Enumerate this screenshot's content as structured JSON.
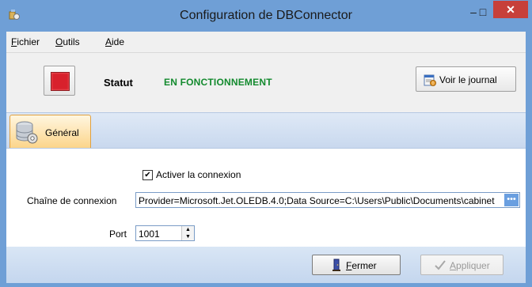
{
  "window": {
    "title": "Configuration de DBConnector",
    "minimize_glyph": "–",
    "maximize_glyph": "□",
    "close_glyph": "✕"
  },
  "menu": {
    "items": [
      {
        "mnemonic": "F",
        "rest": "ichier"
      },
      {
        "mnemonic": "O",
        "rest": "utils"
      },
      {
        "mnemonic": "A",
        "rest": "ide"
      }
    ]
  },
  "status": {
    "label": "Statut",
    "value": "EN FONCTIONNEMENT",
    "value_color": "#138a2e",
    "stop_color": "#d8212c",
    "journal_button": "Voir le journal"
  },
  "tabs": [
    {
      "label": "Général",
      "selected": true
    }
  ],
  "form": {
    "enable_label": "Activer la connexion",
    "enable_checked": true,
    "check_glyph": "✔",
    "connection_label": "Chaîne de connexion",
    "connection_value": "Provider=Microsoft.Jet.OLEDB.4.0;Data Source=C:\\Users\\Public\\Documents\\cabinet",
    "browse_glyph": "•••",
    "port_label": "Port",
    "port_value": "1001",
    "spin_up": "▲",
    "spin_down": "▼"
  },
  "buttons": {
    "close_mnemonic": "F",
    "close_rest": "ermer",
    "apply_mnemonic": "A",
    "apply_rest": "ppliquer",
    "apply_enabled": false
  },
  "icons": {
    "app": "app-icon",
    "stop": "stop-icon",
    "journal": "log-icon",
    "tab_general": "database-settings-icon",
    "close_button": "door-exit-icon",
    "apply_button": "checkmark-icon"
  }
}
